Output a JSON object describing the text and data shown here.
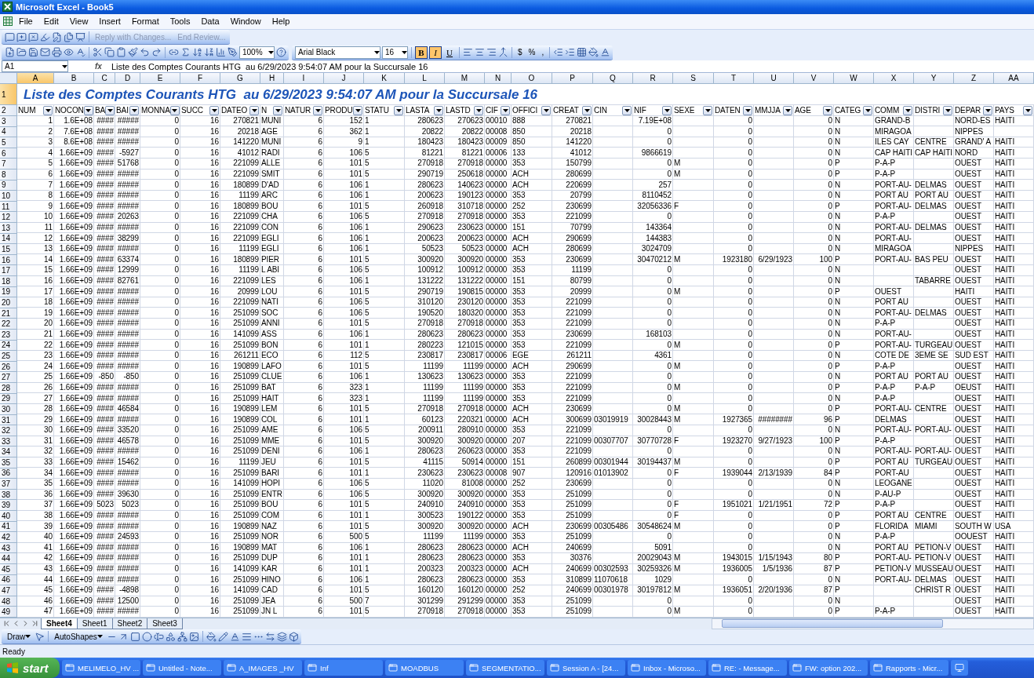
{
  "window": {
    "title": "Microsoft Excel - Book5"
  },
  "menu": [
    {
      "label": "File"
    },
    {
      "label": "Edit"
    },
    {
      "label": "View"
    },
    {
      "label": "Insert"
    },
    {
      "label": "Format"
    },
    {
      "label": "Tools"
    },
    {
      "label": "Data"
    },
    {
      "label": "Window"
    },
    {
      "label": "Help"
    }
  ],
  "reviewing_toolbar": {
    "buttons": [
      {
        "label": "Reply with Changes...",
        "disabled": true
      },
      {
        "label": "End Review...",
        "disabled": true
      }
    ]
  },
  "standard_toolbar": {
    "zoom": "100%"
  },
  "formatting_toolbar": {
    "font": "Arial Black",
    "size": "16",
    "styles": [
      {
        "label": "B",
        "on": true
      },
      {
        "label": "I",
        "on": true
      },
      {
        "label": "U",
        "on": false
      }
    ],
    "number_buttons": [
      {
        "label": "$"
      },
      {
        "label": "%"
      },
      {
        "label": ","
      }
    ]
  },
  "formula_bar": {
    "name_box": "A1",
    "fx_label": "fx",
    "formula": "Liste des Comptes Courants HTG  au 6/29/2023 9:54:07 AM pour la Succursale 16"
  },
  "sheet": {
    "column_letters": [
      {
        "letter": "A",
        "selected": true
      },
      {
        "letter": "B",
        "selected": false
      },
      {
        "letter": "C",
        "selected": false
      },
      {
        "letter": "D",
        "selected": false
      },
      {
        "letter": "E",
        "selected": false
      },
      {
        "letter": "F",
        "selected": false
      },
      {
        "letter": "G",
        "selected": false
      },
      {
        "letter": "H",
        "selected": false
      },
      {
        "letter": "I",
        "selected": false
      },
      {
        "letter": "J",
        "selected": false
      },
      {
        "letter": "K",
        "selected": false
      },
      {
        "letter": "L",
        "selected": false
      },
      {
        "letter": "M",
        "selected": false
      },
      {
        "letter": "N",
        "selected": false
      },
      {
        "letter": "O",
        "selected": false
      },
      {
        "letter": "P",
        "selected": false
      },
      {
        "letter": "Q",
        "selected": false
      },
      {
        "letter": "R",
        "selected": false
      },
      {
        "letter": "S",
        "selected": false
      },
      {
        "letter": "T",
        "selected": false
      },
      {
        "letter": "U",
        "selected": false
      },
      {
        "letter": "V",
        "selected": false
      },
      {
        "letter": "W",
        "selected": false
      },
      {
        "letter": "X",
        "selected": false
      },
      {
        "letter": "Y",
        "selected": false
      },
      {
        "letter": "Z",
        "selected": false
      },
      {
        "letter": "AA",
        "selected": false
      }
    ],
    "title_row": {
      "number": "1",
      "selected": true,
      "text": "Liste des Comptes Courants HTG  au 6/29/2023 9:54:07 AM pour la Succursale 16"
    },
    "header_row": {
      "number": "2",
      "selected": false,
      "headings": [
        {
          "text": "NUM",
          "kind": "number"
        },
        {
          "text": "NOCON",
          "kind": "number"
        },
        {
          "text": "BA",
          "kind": "number"
        },
        {
          "text": "BAI",
          "kind": "number"
        },
        {
          "text": "MONNA",
          "kind": "number"
        },
        {
          "text": "SUCC",
          "kind": "number"
        },
        {
          "text": "DATEO",
          "kind": "number"
        },
        {
          "text": "N",
          "kind": "text"
        },
        {
          "text": "NATUR",
          "kind": "number"
        },
        {
          "text": "PRODU",
          "kind": "number"
        },
        {
          "text": "STATU",
          "kind": "text"
        },
        {
          "text": "LASTA",
          "kind": "number"
        },
        {
          "text": "LASTD",
          "kind": "number"
        },
        {
          "text": "CIF",
          "kind": "text"
        },
        {
          "text": "OFFICI",
          "kind": "text"
        },
        {
          "text": "CREAT",
          "kind": "number"
        },
        {
          "text": "CIN",
          "kind": "text"
        },
        {
          "text": "NIF",
          "kind": "number"
        },
        {
          "text": "SEXE",
          "kind": "text"
        },
        {
          "text": "DATEN",
          "kind": "number"
        },
        {
          "text": "MMJJA",
          "kind": "number"
        },
        {
          "text": "AGE",
          "kind": "number"
        },
        {
          "text": "CATEG",
          "kind": "text"
        },
        {
          "text": "COMM",
          "kind": "text"
        },
        {
          "text": "DISTRI",
          "kind": "text"
        },
        {
          "text": "DEPAR",
          "kind": "text"
        },
        {
          "text": "PAYS",
          "kind": "text"
        }
      ]
    },
    "rows": [
      {
        "number": "3",
        "selected": false,
        "cells": [
          "1",
          "1.6E+08",
          "####",
          "#####",
          "0",
          "16",
          "270821",
          "MUNI",
          "6",
          "152",
          "1",
          "280623",
          "270623",
          "00010",
          "888",
          "270821",
          null,
          "7.19E+08",
          null,
          "0",
          null,
          "0",
          "N",
          "GRAND-B",
          null,
          "NORD-ES",
          "HAITI"
        ]
      },
      {
        "number": "4",
        "selected": false,
        "cells": [
          "2",
          "7.6E+08",
          "####",
          "#####",
          "0",
          "16",
          "20218",
          "AGE",
          "6",
          "362",
          "1",
          "20822",
          "20822",
          "00008",
          "850",
          "20218",
          null,
          "0",
          null,
          "0",
          null,
          "0",
          "N",
          "MIRAGOA",
          null,
          "NIPPES",
          null
        ]
      },
      {
        "number": "5",
        "selected": false,
        "cells": [
          "3",
          "8.6E+08",
          "####",
          "#####",
          "0",
          "16",
          "141220",
          "MUNI",
          "6",
          "9",
          "1",
          "180423",
          "180423",
          "00009",
          "850",
          "141220",
          null,
          "0",
          null,
          "0",
          null,
          "0",
          "N",
          "ILES CAY",
          "CENTRE",
          "GRAND' A",
          "HAITI"
        ]
      },
      {
        "number": "6",
        "selected": false,
        "cells": [
          "4",
          "1.66E+09",
          "####",
          "-5927",
          "0",
          "16",
          "41012",
          "RADI",
          "6",
          "106",
          "5",
          "81221",
          "81221",
          "00006",
          "133",
          "41012",
          null,
          "9866619",
          null,
          "0",
          null,
          "0",
          "N",
          "CAP HAITI",
          "CAP HAITI",
          "NORD",
          "HAITI"
        ]
      },
      {
        "number": "7",
        "selected": false,
        "cells": [
          "5",
          "1.66E+09",
          "####",
          "51768",
          "0",
          "16",
          "221099",
          "ALLE",
          "6",
          "101",
          "5",
          "270918",
          "270918",
          "00000",
          "353",
          "150799",
          null,
          "0",
          "M",
          "0",
          null,
          "0",
          "P",
          "P-A-P",
          null,
          "OUEST",
          "HAITI"
        ]
      },
      {
        "number": "8",
        "selected": false,
        "cells": [
          "6",
          "1.66E+09",
          "####",
          "#####",
          "0",
          "16",
          "221099",
          "SMIT",
          "6",
          "101",
          "5",
          "290719",
          "250618",
          "00000",
          "ACH",
          "280699",
          null,
          "0",
          "M",
          "0",
          null,
          "0",
          "P",
          "P-A-P",
          null,
          "OUEST",
          "HAITI"
        ]
      },
      {
        "number": "9",
        "selected": false,
        "cells": [
          "7",
          "1.66E+09",
          "####",
          "#####",
          "0",
          "16",
          "180899",
          "D'AD",
          "6",
          "106",
          "1",
          "280623",
          "140623",
          "00000",
          "ACH",
          "220699",
          null,
          "257",
          null,
          "0",
          null,
          "0",
          "N",
          "PORT-AU-",
          "DELMAS",
          "OUEST",
          "HAITI"
        ]
      },
      {
        "number": "10",
        "selected": false,
        "cells": [
          "8",
          "1.66E+09",
          "####",
          "#####",
          "0",
          "16",
          "11199",
          "ARC",
          "6",
          "106",
          "1",
          "200623",
          "190123",
          "00000",
          "353",
          "20799",
          null,
          "8110452",
          null,
          "0",
          null,
          "0",
          "N",
          "PORT AU",
          "PORT AU",
          "OUEST",
          "HAITI"
        ]
      },
      {
        "number": "11",
        "selected": false,
        "cells": [
          "9",
          "1.66E+09",
          "####",
          "#####",
          "0",
          "16",
          "180899",
          "BOU",
          "6",
          "101",
          "5",
          "260918",
          "310718",
          "00000",
          "252",
          "230699",
          null,
          "32056336",
          "F",
          "0",
          null,
          "0",
          "P",
          "PORT-AU-",
          "DELMAS",
          "OUEST",
          "HAITI"
        ]
      },
      {
        "number": "12",
        "selected": false,
        "cells": [
          "10",
          "1.66E+09",
          "####",
          "20263",
          "0",
          "16",
          "221099",
          "CHA",
          "6",
          "106",
          "5",
          "270918",
          "270918",
          "00000",
          "353",
          "221099",
          null,
          "0",
          null,
          "0",
          null,
          "0",
          "N",
          "P-A-P",
          null,
          "OUEST",
          "HAITI"
        ]
      },
      {
        "number": "13",
        "selected": false,
        "cells": [
          "11",
          "1.66E+09",
          "####",
          "#####",
          "0",
          "16",
          "221099",
          "CON",
          "6",
          "106",
          "1",
          "290623",
          "230623",
          "00000",
          "151",
          "70799",
          null,
          "143364",
          null,
          "0",
          null,
          "0",
          "N",
          "PORT-AU-",
          "DELMAS",
          "OUEST",
          "HAITI"
        ]
      },
      {
        "number": "14",
        "selected": false,
        "cells": [
          "12",
          "1.66E+09",
          "####",
          "38299",
          "0",
          "16",
          "221099",
          "EGLI",
          "6",
          "106",
          "1",
          "200623",
          "200623",
          "00000",
          "ACH",
          "290699",
          null,
          "144383",
          null,
          "0",
          null,
          "0",
          "N",
          "PORT-AU-",
          null,
          "OUEST",
          "HAITI"
        ]
      },
      {
        "number": "15",
        "selected": false,
        "cells": [
          "13",
          "1.66E+09",
          "####",
          "#####",
          "0",
          "16",
          "11199",
          "EGLI",
          "6",
          "106",
          "1",
          "50523",
          "50523",
          "00000",
          "ACH",
          "280699",
          null,
          "3024709",
          null,
          "0",
          null,
          "0",
          "N",
          "MIRAGOA",
          null,
          "NIPPES",
          "HAITI"
        ]
      },
      {
        "number": "16",
        "selected": false,
        "cells": [
          "14",
          "1.66E+09",
          "####",
          "63374",
          "0",
          "16",
          "180899",
          "PIER",
          "6",
          "101",
          "5",
          "300920",
          "300920",
          "00000",
          "353",
          "230699",
          null,
          "30470212",
          "M",
          "1923180",
          "6/29/1923",
          "100",
          "P",
          "PORT-AU-",
          "BAS PEU",
          "OUEST",
          "HAITI"
        ]
      },
      {
        "number": "17",
        "selected": false,
        "cells": [
          "15",
          "1.66E+09",
          "####",
          "12999",
          "0",
          "16",
          "11199",
          "L ABI",
          "6",
          "106",
          "5",
          "100912",
          "100912",
          "00000",
          "353",
          "11199",
          null,
          "0",
          null,
          "0",
          null,
          "0",
          "N",
          null,
          null,
          "OUEST",
          "HAITI"
        ]
      },
      {
        "number": "18",
        "selected": false,
        "cells": [
          "16",
          "1.66E+09",
          "####",
          "82761",
          "0",
          "16",
          "221099",
          "LES",
          "6",
          "106",
          "1",
          "131222",
          "131222",
          "00000",
          "151",
          "80799",
          null,
          "0",
          null,
          "0",
          null,
          "0",
          "N",
          null,
          "TABARRE",
          "OUEST",
          "HAITI"
        ]
      },
      {
        "number": "19",
        "selected": false,
        "cells": [
          "17",
          "1.66E+09",
          "####",
          "#####",
          "0",
          "16",
          "20999",
          "LOU",
          "6",
          "101",
          "5",
          "290719",
          "190815",
          "00000",
          "353",
          "20999",
          null,
          "0",
          "M",
          "0",
          null,
          "0",
          "P",
          "OUEST",
          null,
          "HAITI",
          "HAITI"
        ]
      },
      {
        "number": "20",
        "selected": false,
        "cells": [
          "18",
          "1.66E+09",
          "####",
          "#####",
          "0",
          "16",
          "221099",
          "NATI",
          "6",
          "106",
          "5",
          "310120",
          "230120",
          "00000",
          "353",
          "221099",
          null,
          "0",
          null,
          "0",
          null,
          "0",
          "N",
          "PORT AU",
          null,
          "OUEST",
          "HAITI"
        ]
      },
      {
        "number": "21",
        "selected": false,
        "cells": [
          "19",
          "1.66E+09",
          "####",
          "#####",
          "0",
          "16",
          "251099",
          "SOC",
          "6",
          "106",
          "5",
          "190520",
          "180320",
          "00000",
          "353",
          "221099",
          null,
          "0",
          null,
          "0",
          null,
          "0",
          "N",
          "PORT-AU-",
          "DELMAS",
          "OUEST",
          "HAITI"
        ]
      },
      {
        "number": "22",
        "selected": false,
        "cells": [
          "20",
          "1.66E+09",
          "####",
          "#####",
          "0",
          "16",
          "251099",
          "ANNI",
          "6",
          "101",
          "5",
          "270918",
          "270918",
          "00000",
          "353",
          "221099",
          null,
          "0",
          null,
          "0",
          null,
          "0",
          "N",
          "P-A-P",
          null,
          "OUEST",
          "HAITI"
        ]
      },
      {
        "number": "23",
        "selected": false,
        "cells": [
          "21",
          "1.66E+09",
          "####",
          "#####",
          "0",
          "16",
          "141099",
          "ASS",
          "6",
          "106",
          "1",
          "280623",
          "280623",
          "00000",
          "353",
          "230699",
          null,
          "168103",
          null,
          "0",
          null,
          "0",
          "N",
          "PORT-AU-",
          null,
          "OUEST",
          "HAITI"
        ]
      },
      {
        "number": "24",
        "selected": false,
        "cells": [
          "22",
          "1.66E+09",
          "####",
          "#####",
          "0",
          "16",
          "251099",
          "BON",
          "6",
          "101",
          "1",
          "280223",
          "121015",
          "00000",
          "353",
          "221099",
          null,
          "0",
          "M",
          "0",
          null,
          "0",
          "P",
          "PORT-AU-",
          "TURGEAU",
          "OUEST",
          "HAITI"
        ]
      },
      {
        "number": "25",
        "selected": false,
        "cells": [
          "23",
          "1.66E+09",
          "####",
          "#####",
          "0",
          "16",
          "261211",
          "ECO",
          "6",
          "112",
          "5",
          "230817",
          "230817",
          "00006",
          "EGE",
          "261211",
          null,
          "4361",
          null,
          "0",
          null,
          "0",
          "N",
          "COTE DE",
          "3EME SE",
          "SUD EST",
          "HAITI"
        ]
      },
      {
        "number": "26",
        "selected": false,
        "cells": [
          "24",
          "1.66E+09",
          "####",
          "#####",
          "0",
          "16",
          "190899",
          "LAFO",
          "6",
          "101",
          "5",
          "11199",
          "11199",
          "00000",
          "ACH",
          "290699",
          null,
          "0",
          "M",
          "0",
          null,
          "0",
          "P",
          "P-A-P",
          null,
          "OUEST",
          "HAITI"
        ]
      },
      {
        "number": "27",
        "selected": false,
        "cells": [
          "25",
          "1.66E+09",
          "-850",
          "-850",
          "0",
          "16",
          "251099",
          "CLUE",
          "6",
          "106",
          "1",
          "130623",
          "130623",
          "00000",
          "353",
          "221099",
          null,
          "0",
          null,
          "0",
          null,
          "0",
          "N",
          "PORT AU",
          "PORT AU",
          "OUEST",
          "HAITI"
        ]
      },
      {
        "number": "28",
        "selected": false,
        "cells": [
          "26",
          "1.66E+09",
          "####",
          "#####",
          "0",
          "16",
          "251099",
          "BAT",
          "6",
          "323",
          "1",
          "11199",
          "11199",
          "00000",
          "353",
          "221099",
          null,
          "0",
          "M",
          "0",
          null,
          "0",
          "P",
          "P-A-P",
          "P-A-P",
          "OEUST",
          "HAITI"
        ]
      },
      {
        "number": "29",
        "selected": false,
        "cells": [
          "27",
          "1.66E+09",
          "####",
          "#####",
          "0",
          "16",
          "251099",
          "HAIT",
          "6",
          "323",
          "1",
          "11199",
          "11199",
          "00000",
          "353",
          "221099",
          null,
          "0",
          null,
          "0",
          null,
          "0",
          "N",
          "P-A-P",
          null,
          "OUEST",
          "HAITI"
        ]
      },
      {
        "number": "30",
        "selected": false,
        "cells": [
          "28",
          "1.66E+09",
          "####",
          "46584",
          "0",
          "16",
          "190899",
          "LEM",
          "6",
          "101",
          "5",
          "270918",
          "270918",
          "00000",
          "ACH",
          "230699",
          null,
          "0",
          "M",
          "0",
          null,
          "0",
          "P",
          "PORT-AU-",
          "CENTRE",
          "OUEST",
          "HAITI"
        ]
      },
      {
        "number": "31",
        "selected": false,
        "cells": [
          "29",
          "1.66E+09",
          "####",
          "#####",
          "0",
          "16",
          "190899",
          "COL",
          "6",
          "101",
          "1",
          "60123",
          "220321",
          "00000",
          "ACH",
          "300699",
          "03019919",
          "30028443",
          "M",
          "1927365",
          "########",
          "96",
          "P",
          "DELMAS",
          null,
          "OUEST",
          "HAITI"
        ]
      },
      {
        "number": "32",
        "selected": false,
        "cells": [
          "30",
          "1.66E+09",
          "####",
          "33520",
          "0",
          "16",
          "251099",
          "AME",
          "6",
          "106",
          "5",
          "200911",
          "280910",
          "00000",
          "353",
          "221099",
          null,
          "0",
          null,
          "0",
          null,
          "0",
          "N",
          "PORT-AU-",
          "PORT-AU-",
          "OUEST",
          "HAITI"
        ]
      },
      {
        "number": "33",
        "selected": false,
        "cells": [
          "31",
          "1.66E+09",
          "####",
          "46578",
          "0",
          "16",
          "251099",
          "MME",
          "6",
          "101",
          "5",
          "300920",
          "300920",
          "00000",
          "207",
          "221099",
          "00307707",
          "30770728",
          "F",
          "1923270",
          "9/27/1923",
          "100",
          "P",
          "P-A-P",
          null,
          "OUEST",
          "HAITI"
        ]
      },
      {
        "number": "34",
        "selected": false,
        "cells": [
          "32",
          "1.66E+09",
          "####",
          "#####",
          "0",
          "16",
          "251099",
          "DENI",
          "6",
          "106",
          "1",
          "280623",
          "260623",
          "00000",
          "353",
          "221099",
          null,
          "0",
          null,
          "0",
          null,
          "0",
          "N",
          "PORT-AU-",
          "PORT-AU-",
          "OUEST",
          "HAITI"
        ]
      },
      {
        "number": "35",
        "selected": false,
        "cells": [
          "33",
          "1.66E+09",
          "####",
          "15462",
          "0",
          "16",
          "11199",
          "JEU",
          "6",
          "101",
          "5",
          "41115",
          "50914",
          "00000",
          "151",
          "260899",
          "00301944",
          "30194437",
          "M",
          "0",
          null,
          "0",
          "P",
          "PORT AU",
          "TURGEAU",
          "OUEST",
          "HAITI"
        ]
      },
      {
        "number": "36",
        "selected": false,
        "cells": [
          "34",
          "1.66E+09",
          "####",
          "#####",
          "0",
          "16",
          "251099",
          "BARI",
          "6",
          "101",
          "1",
          "230623",
          "230623",
          "00008",
          "907",
          "120916",
          "01013902",
          "0",
          "F",
          "1939044",
          "2/13/1939",
          "84",
          "P",
          "PORT-AU",
          null,
          "OUEST",
          "HAITI"
        ]
      },
      {
        "number": "37",
        "selected": false,
        "cells": [
          "35",
          "1.66E+09",
          "####",
          "#####",
          "0",
          "16",
          "141099",
          "HOPI",
          "6",
          "106",
          "5",
          "11020",
          "81008",
          "00000",
          "252",
          "230699",
          null,
          "0",
          null,
          "0",
          null,
          "0",
          "N",
          "LEOGANE",
          null,
          "OUEST",
          "HAITI"
        ]
      },
      {
        "number": "38",
        "selected": false,
        "cells": [
          "36",
          "1.66E+09",
          "####",
          "39630",
          "0",
          "16",
          "251099",
          "ENTR",
          "6",
          "106",
          "5",
          "300920",
          "300920",
          "00000",
          "353",
          "251099",
          null,
          "0",
          null,
          "0",
          null,
          "0",
          "N",
          "P-AU-P",
          null,
          "OUEST",
          "HAITI"
        ]
      },
      {
        "number": "39",
        "selected": false,
        "cells": [
          "37",
          "1.66E+09",
          "5023",
          "5023",
          "0",
          "16",
          "251099",
          "BOU",
          "6",
          "101",
          "5",
          "240910",
          "240910",
          "00000",
          "353",
          "251099",
          null,
          "0",
          "F",
          "1951021",
          "1/21/1951",
          "72",
          "P",
          "P-A-P",
          null,
          "OUEST",
          "HAITI"
        ]
      },
      {
        "number": "40",
        "selected": false,
        "cells": [
          "38",
          "1.66E+09",
          "####",
          "#####",
          "0",
          "16",
          "251099",
          "COM",
          "6",
          "101",
          "1",
          "300523",
          "190122",
          "00000",
          "353",
          "251099",
          null,
          "0",
          "F",
          "0",
          null,
          "0",
          "P",
          "PORT AU",
          "CENTRE",
          "OUEST",
          "HAITI"
        ]
      },
      {
        "number": "41",
        "selected": false,
        "cells": [
          "39",
          "1.66E+09",
          "####",
          "#####",
          "0",
          "16",
          "190899",
          "NAZ",
          "6",
          "101",
          "5",
          "300920",
          "300920",
          "00000",
          "ACH",
          "230699",
          "00305486",
          "30548624",
          "M",
          "0",
          null,
          "0",
          "P",
          "FLORIDA",
          "MIAMI",
          "SOUTH W",
          "USA"
        ]
      },
      {
        "number": "42",
        "selected": false,
        "cells": [
          "40",
          "1.66E+09",
          "####",
          "24593",
          "0",
          "16",
          "251099",
          "NOR",
          "6",
          "500",
          "5",
          "11199",
          "11199",
          "00000",
          "353",
          "251099",
          null,
          "0",
          null,
          "0",
          null,
          "0",
          "N",
          "P-A-P",
          null,
          "OOUEST",
          "HAITI"
        ]
      },
      {
        "number": "43",
        "selected": false,
        "cells": [
          "41",
          "1.66E+09",
          "####",
          "#####",
          "0",
          "16",
          "190899",
          "MAT",
          "6",
          "106",
          "1",
          "280623",
          "280623",
          "00000",
          "ACH",
          "240699",
          null,
          "5091",
          null,
          "0",
          null,
          "0",
          "N",
          "PORT AU",
          "PETION-V",
          "OUEST",
          "HAITI"
        ]
      },
      {
        "number": "44",
        "selected": false,
        "cells": [
          "42",
          "1.66E+09",
          "####",
          "#####",
          "0",
          "16",
          "251099",
          "DUP",
          "6",
          "101",
          "1",
          "280623",
          "280623",
          "00000",
          "353",
          "30376",
          null,
          "20029043",
          "M",
          "1943015",
          "1/15/1943",
          "80",
          "P",
          "PORT-AU-",
          "PETION-V",
          "OUEST",
          "HAITI"
        ]
      },
      {
        "number": "45",
        "selected": false,
        "cells": [
          "43",
          "1.66E+09",
          "####",
          "#####",
          "0",
          "16",
          "141099",
          "KAR",
          "6",
          "101",
          "1",
          "200323",
          "200323",
          "00000",
          "ACH",
          "240699",
          "00302593",
          "30259326",
          "M",
          "1936005",
          "1/5/1936",
          "87",
          "P",
          "PETION-V",
          "MUSSEAU",
          "OUEST",
          "HAITI"
        ]
      },
      {
        "number": "46",
        "selected": false,
        "cells": [
          "44",
          "1.66E+09",
          "####",
          "#####",
          "0",
          "16",
          "251099",
          "HINO",
          "6",
          "106",
          "1",
          "280623",
          "280623",
          "00000",
          "353",
          "310899",
          "11070618",
          "1029",
          null,
          "0",
          null,
          "0",
          "N",
          "PORT-AU-",
          "DELMAS",
          "OUEST",
          "HAITI"
        ]
      },
      {
        "number": "47",
        "selected": false,
        "cells": [
          "45",
          "1.66E+09",
          "####",
          "-4898",
          "0",
          "16",
          "141099",
          "CAD",
          "6",
          "101",
          "5",
          "160120",
          "160120",
          "00000",
          "252",
          "240699",
          "00301978",
          "30197812",
          "M",
          "1936051",
          "2/20/1936",
          "87",
          "P",
          null,
          "CHRIST R",
          "OUEST",
          "HAITI"
        ]
      },
      {
        "number": "48",
        "selected": false,
        "cells": [
          "46",
          "1.66E+09",
          "####",
          "12500",
          "0",
          "16",
          "251099",
          "JEA",
          "6",
          "500",
          "7",
          "301299",
          "291299",
          "00000",
          "353",
          "251099",
          null,
          "0",
          null,
          "0",
          null,
          "0",
          "N",
          null,
          null,
          "OUEST",
          "HAITI"
        ]
      },
      {
        "number": "49",
        "selected": false,
        "cells": [
          "47",
          "1.66E+09",
          "####",
          "#####",
          "0",
          "16",
          "251099",
          "JN L",
          "6",
          "101",
          "5",
          "270918",
          "270918",
          "00000",
          "353",
          "251099",
          null,
          "0",
          "M",
          "0",
          null,
          "0",
          "P",
          "P-A-P",
          null,
          "OUEST",
          "HAITI"
        ]
      }
    ]
  },
  "sheet_tabs": [
    {
      "label": "Sheet4",
      "selected": true
    },
    {
      "label": "Sheet1",
      "selected": false
    },
    {
      "label": "Sheet2",
      "selected": false
    },
    {
      "label": "Sheet3",
      "selected": false
    }
  ],
  "drawing_toolbar": {
    "draw": "Draw",
    "autoshapes": "AutoShapes"
  },
  "status_bar": {
    "text": "Ready"
  },
  "taskbar": {
    "start": "start",
    "items": [
      {
        "label": "MELIMELO_HV ..."
      },
      {
        "label": "Untitled - Note..."
      },
      {
        "label": "A_IMAGES _HV"
      },
      {
        "label": "Inf"
      },
      {
        "label": "MOADBUS"
      },
      {
        "label": "SEGMENTATIO..."
      },
      {
        "label": "Session A - [24..."
      },
      {
        "label": "Inbox - Microso..."
      },
      {
        "label": "RE: - Message..."
      },
      {
        "label": "FW: option 202..."
      },
      {
        "label": "Rapports - Micr..."
      }
    ]
  }
}
